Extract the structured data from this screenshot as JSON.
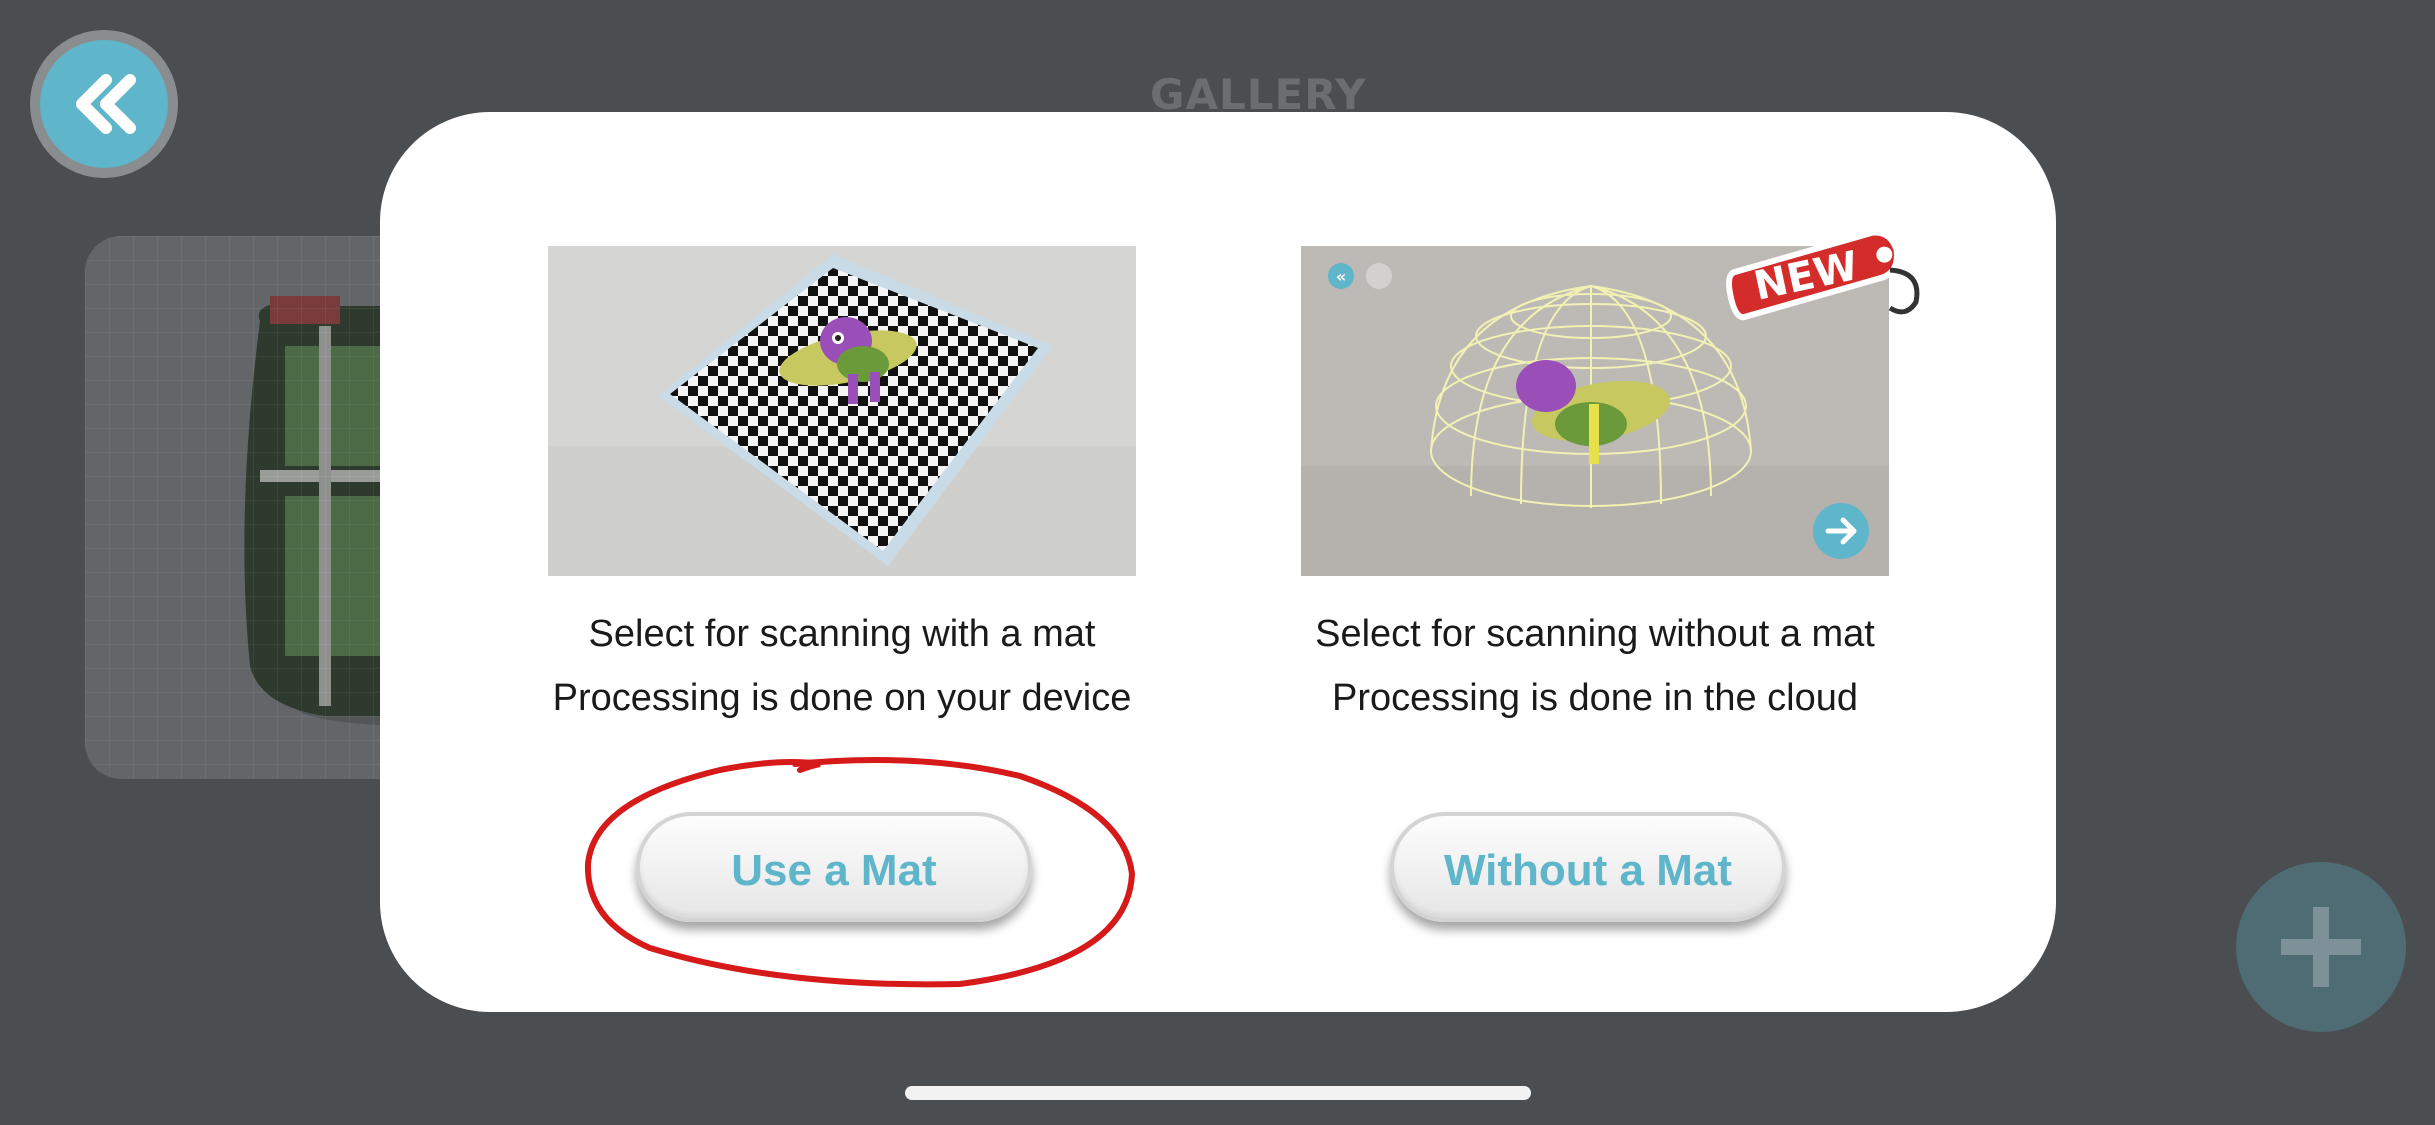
{
  "header": {
    "title": "GALLERY"
  },
  "back_button": {
    "icon": "double-chevron-left-icon"
  },
  "add_button": {
    "icon": "plus-icon"
  },
  "options": [
    {
      "id": "with-mat",
      "line1": "Select for scanning with a mat",
      "line2": "Processing is done on your device",
      "button_label": "Use a Mat"
    },
    {
      "id": "without-mat",
      "line1": "Select for scanning without a mat",
      "line2": "Processing is done in the cloud",
      "button_label": "Without a Mat",
      "badge": "NEW"
    }
  ],
  "colors": {
    "accent": "#5fb5c9",
    "badge": "#d42b2b",
    "annotation": "#d61a1a",
    "backdrop": "#4a4e51"
  }
}
